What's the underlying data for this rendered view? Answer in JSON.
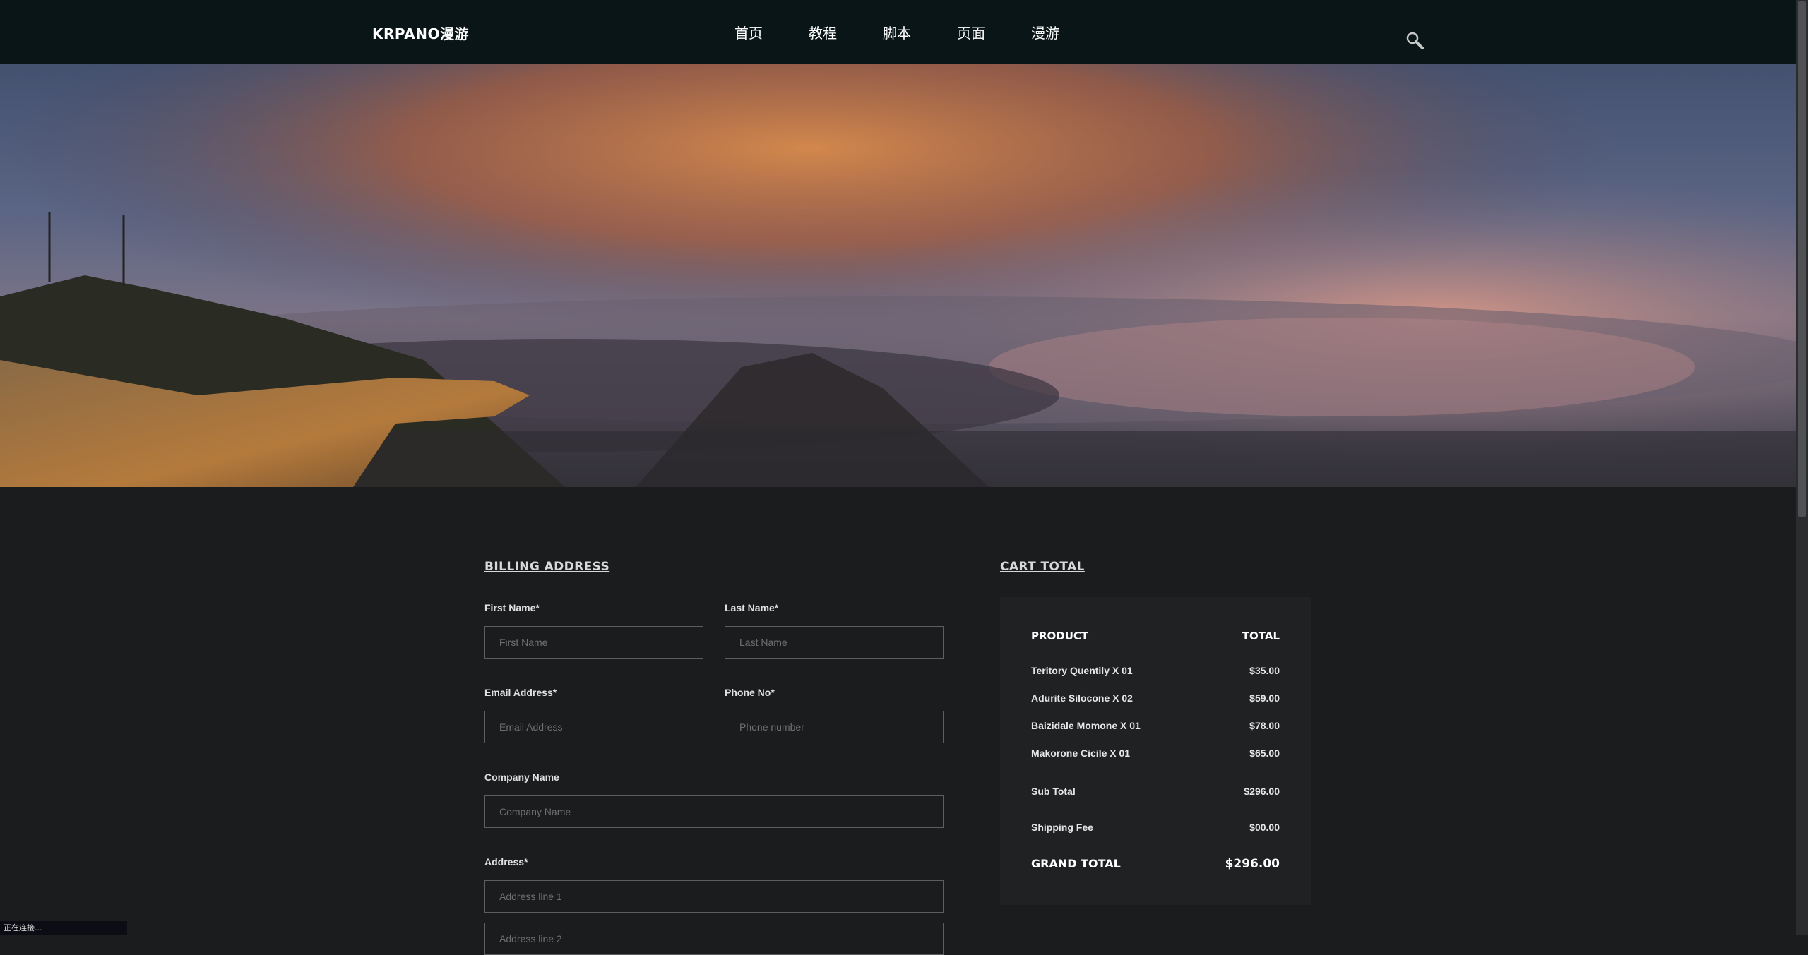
{
  "header": {
    "logo": "KRPANO漫游",
    "nav": [
      "首页",
      "教程",
      "脚本",
      "页面",
      "漫游"
    ]
  },
  "billing": {
    "title": "BILLING ADDRESS",
    "first_name_label": "First Name*",
    "first_name_placeholder": "First Name",
    "last_name_label": "Last Name*",
    "last_name_placeholder": "Last Name",
    "email_label": "Email Address*",
    "email_placeholder": "Email Address",
    "phone_label": "Phone No*",
    "phone_placeholder": "Phone number",
    "company_label": "Company Name",
    "company_placeholder": "Company Name",
    "address_label": "Address*",
    "address1_placeholder": "Address line 1",
    "address2_placeholder": "Address line 2"
  },
  "cart": {
    "title": "CART TOTAL",
    "col_product": "PRODUCT",
    "col_total": "TOTAL",
    "items": [
      {
        "name": "Teritory Quentily X 01",
        "price": "$35.00"
      },
      {
        "name": "Adurite Silocone X 02",
        "price": "$59.00"
      },
      {
        "name": "Baizidale Momone X 01",
        "price": "$78.00"
      },
      {
        "name": "Makorone Cicile X 01",
        "price": "$65.00"
      }
    ],
    "subtotal_label": "Sub Total",
    "subtotal_value": "$296.00",
    "shipping_label": "Shipping Fee",
    "shipping_value": "$00.00",
    "grand_label": "GRAND TOTAL",
    "grand_value": "$296.00"
  },
  "status": "正在连接..."
}
